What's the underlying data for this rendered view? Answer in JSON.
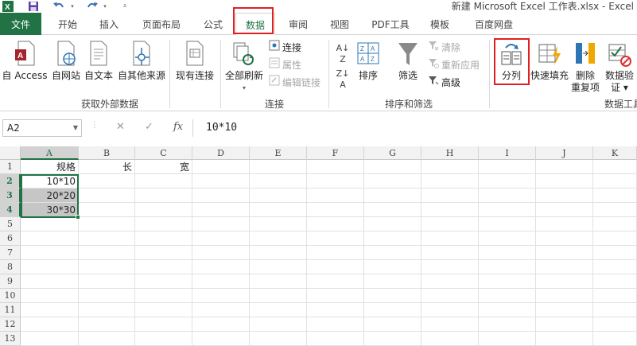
{
  "title_bar": {
    "title": "新建 Microsoft Excel 工作表.xlsx - Excel",
    "quick_access": [
      "excel-logo-icon",
      "save-icon",
      "undo-icon",
      "redo-icon",
      "customize-icon"
    ]
  },
  "tabs": [
    {
      "label": "文件",
      "state": "file"
    },
    {
      "label": "开始",
      "state": ""
    },
    {
      "label": "插入",
      "state": ""
    },
    {
      "label": "页面布局",
      "state": ""
    },
    {
      "label": "公式",
      "state": ""
    },
    {
      "label": "数据",
      "state": "active"
    },
    {
      "label": "审阅",
      "state": ""
    },
    {
      "label": "视图",
      "state": ""
    },
    {
      "label": "PDF工具",
      "state": ""
    },
    {
      "label": "模板",
      "state": ""
    },
    {
      "label": "百度网盘",
      "state": ""
    }
  ],
  "ribbon": {
    "get_external": {
      "label": "获取外部数据",
      "buttons": [
        "自 Access",
        "自网站",
        "自文本",
        "自其他来源",
        "现有连接"
      ]
    },
    "connections": {
      "label": "连接",
      "refresh_all": "全部刷新",
      "connections": "连接",
      "properties": "属性",
      "edit_links": "编辑链接"
    },
    "sort_filter": {
      "label": "排序和筛选",
      "sort": "排序",
      "filter": "筛选",
      "clear": "清除",
      "reapply": "重新应用",
      "advanced": "高级"
    },
    "data_tools": {
      "label": "数据工具",
      "text_to_columns": "分列",
      "flash_fill": "快速填充",
      "remove_duplicates_1": "删除",
      "remove_duplicates_2": "重复项",
      "validation_1": "数据验",
      "validation_2": "证 ▾"
    }
  },
  "formula_bar": {
    "name_box": "A2",
    "cancel": "✕",
    "enter": "✓",
    "fx": "fx",
    "formula": "10*10"
  },
  "sheet": {
    "columns": [
      "A",
      "B",
      "C",
      "D",
      "E",
      "F",
      "G",
      "H",
      "I",
      "J",
      "K"
    ],
    "selected_column": "A",
    "rows": [
      "1",
      "2",
      "3",
      "4",
      "5",
      "6",
      "7",
      "8",
      "9",
      "10",
      "11",
      "12",
      "13"
    ],
    "selected_rows": [
      "2",
      "3",
      "4"
    ],
    "cells": {
      "A1": "规格",
      "B1": "长",
      "C1": "宽",
      "A2": "10*10",
      "A3": "20*20",
      "A4": "30*30"
    }
  },
  "colors": {
    "accent": "#217346",
    "highlight": "#e02020",
    "selection_shade": "#c6c6c6"
  }
}
